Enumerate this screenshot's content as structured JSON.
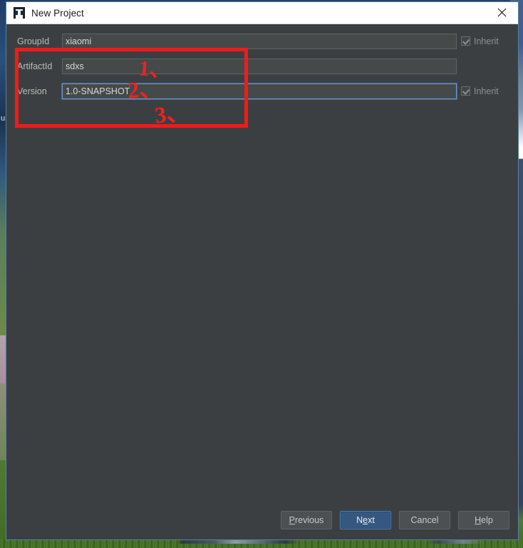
{
  "window": {
    "title": "New Project",
    "app_icon": "intellij-idea-icon",
    "close_icon": "close-icon"
  },
  "form": {
    "rows": [
      {
        "label": "GroupId",
        "value": "xiaomi",
        "focused": false,
        "inherit_label": "Inherit",
        "inherit_checked": true,
        "has_inherit": true
      },
      {
        "label": "ArtifactId",
        "value": "sdxs",
        "focused": false,
        "inherit_label": "",
        "inherit_checked": false,
        "has_inherit": false
      },
      {
        "label": "Version",
        "value": "1.0-SNAPSHOT",
        "focused": true,
        "inherit_label": "Inherit",
        "inherit_checked": true,
        "has_inherit": true
      }
    ]
  },
  "annotations": {
    "highlight_color": "#f31a1a",
    "marks": [
      {
        "text": "1、"
      },
      {
        "text": "2、"
      },
      {
        "text": "3、"
      }
    ]
  },
  "footer": {
    "previous": {
      "pre": "",
      "mnemonic": "P",
      "post": "revious"
    },
    "next": {
      "pre": "N",
      "mnemonic": "e",
      "post": "xt"
    },
    "cancel": {
      "pre": "Cancel",
      "mnemonic": "",
      "post": ""
    },
    "help": {
      "pre": "",
      "mnemonic": "H",
      "post": "elp"
    }
  },
  "colors": {
    "panel_bg": "#3c3f41",
    "field_bg": "#45494a",
    "primary_button": "#365880",
    "focus_border": "#6b9bd2",
    "titlebar_bg": "#ffffff"
  }
}
